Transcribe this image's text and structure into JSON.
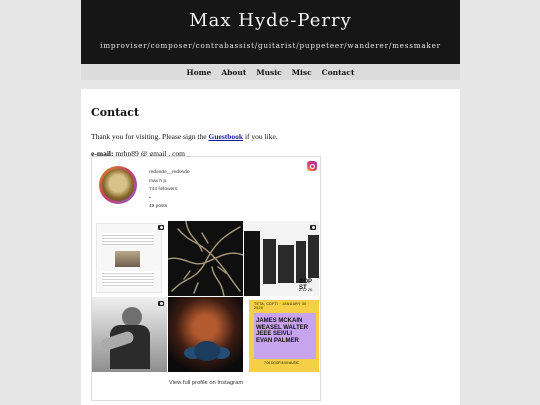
{
  "site": {
    "title": "Max Hyde-Perry",
    "tagline": "improviser/composer/contrabassist/guitarist/puppeteer/wanderer/messmaker"
  },
  "nav": [
    "Home",
    "About",
    "Music",
    "Misc",
    "Contact"
  ],
  "page": {
    "heading": "Contact",
    "intro_prefix": "Thank you for visiting. Please sign the ",
    "guestbook": "Guestbook",
    "intro_suffix": " if you like.",
    "email_label": "e-mail:",
    "email_value": " mrhp89 @ gmail . com"
  },
  "instagram": {
    "username": "redondo__redondo",
    "display_name": "max h p.",
    "followers": "744 followers",
    "separator": "•",
    "posts": "49 posts",
    "view_full": "View full profile on Instagram",
    "tile3_text": "BOP ST",
    "tile3_small": "2.12.26",
    "tile6": {
      "top": "TETA, CDFTI · JANUARY 30 · 2026",
      "names": [
        "JAMES MCKAIN",
        "WEASEL WALTER",
        "JEEE SEIVLI",
        "EVAN PALMER"
      ],
      "bottom": "7:00 DOOR    8:00 MUSIC"
    }
  }
}
